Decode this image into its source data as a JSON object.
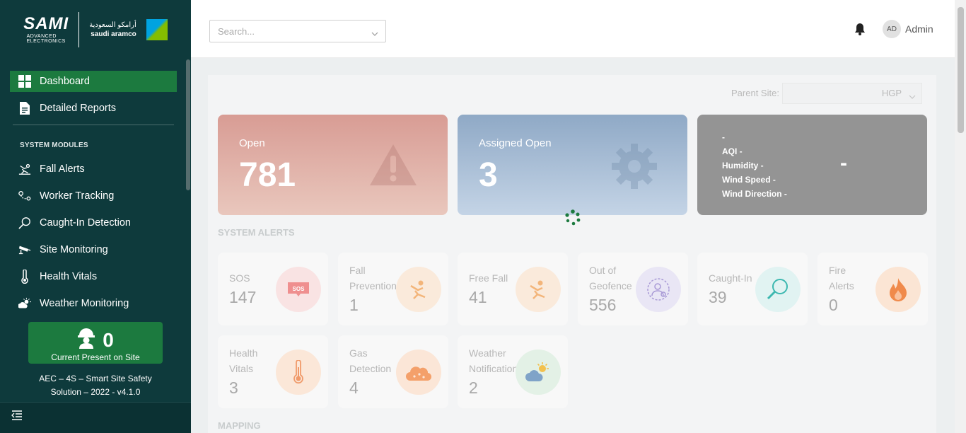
{
  "branding": {
    "sami_text": "SAMI",
    "sami_sub": "ADVANCED\nELECTRONICS",
    "aramco_ar": "أرامكو السعودية",
    "aramco_en": "saudi aramco"
  },
  "sidebar": {
    "nav": [
      {
        "label": "Dashboard",
        "icon": "grid-icon"
      },
      {
        "label": "Detailed Reports",
        "icon": "document-icon"
      }
    ],
    "section_heading": "SYSTEM MODULES",
    "modules": [
      {
        "label": "Fall Alerts",
        "icon": "fall-icon"
      },
      {
        "label": "Worker Tracking",
        "icon": "route-icon"
      },
      {
        "label": "Caught-In Detection",
        "icon": "magnifier-icon"
      },
      {
        "label": "Site Monitoring",
        "icon": "cctv-icon"
      },
      {
        "label": "Health Vitals",
        "icon": "thermometer-icon"
      },
      {
        "label": "Weather Monitoring",
        "icon": "weather-icon"
      }
    ],
    "present": {
      "count": "0",
      "label": "Current Present on Site"
    },
    "version_line1": "AEC – 4S – Smart Site Safety",
    "version_line2": "Solution – 2022 - v4.1.0"
  },
  "header": {
    "search_placeholder": "Search...",
    "avatar_initials": "AD",
    "user_name": "Admin"
  },
  "filters": {
    "parent_site_label": "Parent Site:",
    "parent_site_value": "HGP"
  },
  "summary": {
    "open": {
      "label": "Open",
      "value": "781"
    },
    "assigned": {
      "label": "Assigned Open",
      "value": "3"
    },
    "weather": {
      "line1": "-",
      "line2": "AQI -",
      "line3": "Humidity -",
      "line4": "Wind Speed -",
      "line5": "Wind Direction -",
      "value": "-"
    }
  },
  "sections": {
    "alerts_title": "SYSTEM ALERTS",
    "mapping_title": "MAPPING"
  },
  "alerts": [
    {
      "title": "SOS",
      "value": "147",
      "color": "#f9e3e3",
      "icon": "sos-icon"
    },
    {
      "title": "Fall Prevention",
      "value": "1",
      "color": "#faeadb",
      "icon": "fall-icon"
    },
    {
      "title": "Free Fall",
      "value": "41",
      "color": "#faeadb",
      "icon": "fall-icon"
    },
    {
      "title": "Out of Geofence",
      "value": "556",
      "color": "#e9e6f5",
      "icon": "geofence-worker-icon"
    },
    {
      "title": "Caught-In",
      "value": "39",
      "color": "#e1f3f2",
      "icon": "magnifier-icon"
    },
    {
      "title": "Fire Alerts",
      "value": "0",
      "color": "#fbe5d4",
      "icon": "fire-icon"
    },
    {
      "title": "Health Vitals",
      "value": "3",
      "color": "#fbe7d8",
      "icon": "thermometer-icon"
    },
    {
      "title": "Gas Detection",
      "value": "4",
      "color": "#fbe6d7",
      "icon": "gas-cloud-icon"
    },
    {
      "title": "Weather Notifications",
      "value": "2",
      "color": "#e3f1e6",
      "icon": "weather-icon"
    }
  ]
}
